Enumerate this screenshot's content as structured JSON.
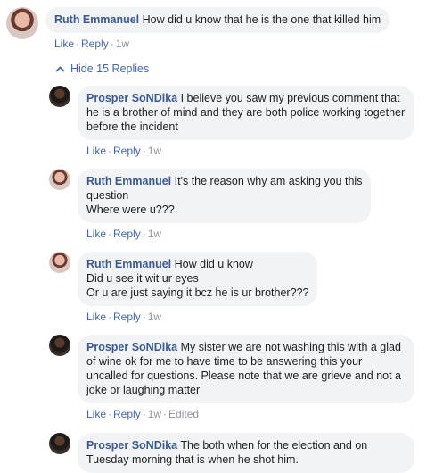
{
  "top_comment": {
    "author": "Ruth Emmanuel",
    "text": "How did u know that he is the one that killed him",
    "like": "Like",
    "reply": "Reply",
    "time": "1w"
  },
  "hide_replies": {
    "label": "Hide 15 Replies",
    "icon": "chevron-up-icon"
  },
  "replies": [
    {
      "author": "Prosper SoNDika",
      "text": "I believe you saw my previous comment that he is a brother of mind and they are both police working together before the incident",
      "like": "Like",
      "reply": "Reply",
      "time": "1w",
      "edited": ""
    },
    {
      "author": "Ruth Emmanuel",
      "text_lines": [
        "It's the reason why am asking you this",
        "question",
        "Where were u???"
      ],
      "like": "Like",
      "reply": "Reply",
      "time": "1w",
      "edited": ""
    },
    {
      "author": "Ruth Emmanuel",
      "text_lines": [
        "How did u know",
        "Did u see it wit ur eyes",
        "Or u are just saying it bcz he is ur brother???"
      ],
      "like": "Like",
      "reply": "Reply",
      "time": "1w",
      "edited": ""
    },
    {
      "author": "Prosper SoNDika",
      "text": "My sister we are not washing this with a glad of wine ok for me to have time to be answering this your uncalled for questions. Please note that we are grieve and not a joke or laughing matter",
      "like": "Like",
      "reply": "Reply",
      "time": "1w",
      "edited": "Edited"
    },
    {
      "author": "Prosper SoNDika",
      "text": "The both when for the election and on Tuesday morning that is when he shot him."
    }
  ],
  "colors": {
    "link": "#4267b2",
    "author": "#385898",
    "bubble": "#f2f3f5",
    "meta": "#90949c"
  }
}
